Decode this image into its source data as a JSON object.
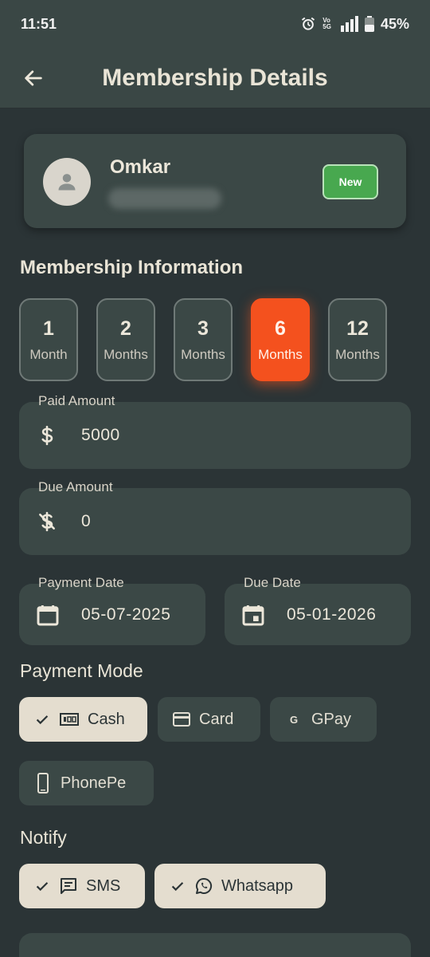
{
  "status_bar": {
    "time": "11:51",
    "net_top": "Vo",
    "net_bottom": "5G",
    "battery": "45%"
  },
  "header": {
    "title": "Membership Details"
  },
  "profile": {
    "name": "Omkar",
    "badge": "New"
  },
  "membership": {
    "title": "Membership Information",
    "durations": [
      {
        "num": "1",
        "unit": "Month"
      },
      {
        "num": "2",
        "unit": "Months"
      },
      {
        "num": "3",
        "unit": "Months"
      },
      {
        "num": "6",
        "unit": "Months"
      },
      {
        "num": "12",
        "unit": "Months"
      }
    ],
    "selected_index": 3
  },
  "paid": {
    "label": "Paid Amount",
    "value": "5000"
  },
  "due": {
    "label": "Due Amount",
    "value": "0"
  },
  "payment_date": {
    "label": "Payment Date",
    "value": "05-07-2025"
  },
  "due_date": {
    "label": "Due Date",
    "value": "05-01-2026"
  },
  "payment_mode": {
    "title": "Payment Mode",
    "options": [
      "Cash",
      "Card",
      "GPay",
      "PhonePe"
    ],
    "selected": "Cash"
  },
  "notify": {
    "title": "Notify",
    "options": [
      "SMS",
      "Whatsapp"
    ],
    "selected": [
      "SMS",
      "Whatsapp"
    ]
  },
  "colors": {
    "background": "#2b3436",
    "surface": "#3b4846",
    "accent": "#f4511e",
    "new_badge": "#48a84f",
    "chip_selected": "#e4ddcf"
  }
}
